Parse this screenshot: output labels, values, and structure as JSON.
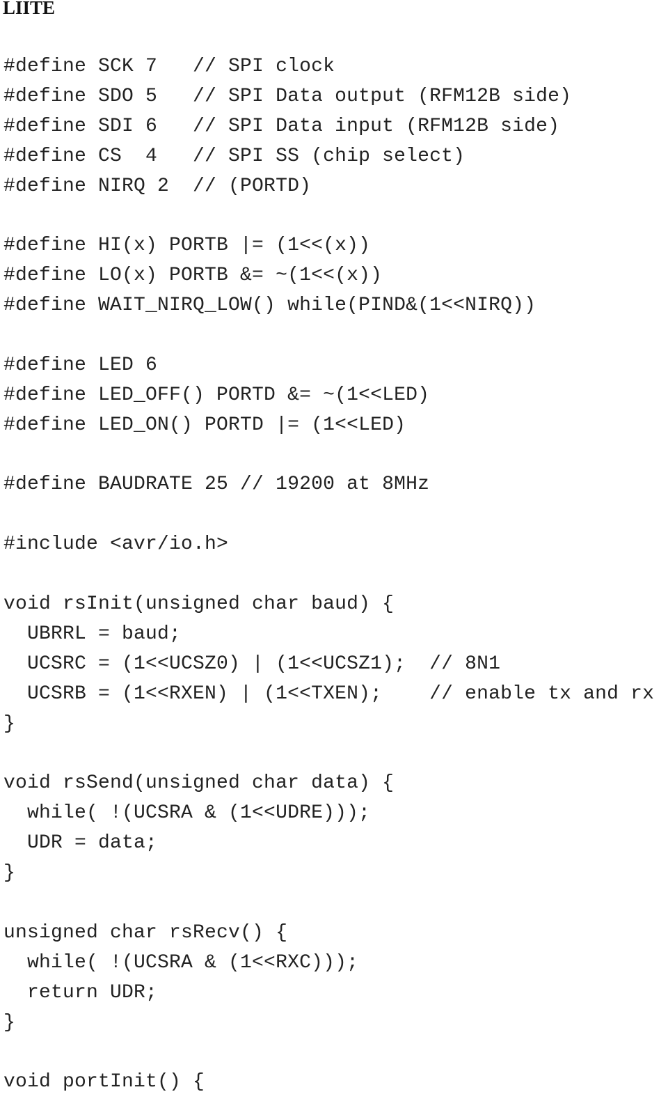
{
  "document": {
    "heading": "LIITE",
    "code_lines": [
      "#define SCK 7   // SPI clock",
      "#define SDO 5   // SPI Data output (RFM12B side)",
      "#define SDI 6   // SPI Data input (RFM12B side)",
      "#define CS  4   // SPI SS (chip select)",
      "#define NIRQ 2  // (PORTD)",
      "",
      "#define HI(x) PORTB |= (1<<(x))",
      "#define LO(x) PORTB &= ~(1<<(x))",
      "#define WAIT_NIRQ_LOW() while(PIND&(1<<NIRQ))",
      "",
      "#define LED 6",
      "#define LED_OFF() PORTD &= ~(1<<LED)",
      "#define LED_ON() PORTD |= (1<<LED)",
      "",
      "#define BAUDRATE 25 // 19200 at 8MHz",
      "",
      "#include <avr/io.h>",
      "",
      "void rsInit(unsigned char baud) {",
      "  UBRRL = baud;",
      "  UCSRC = (1<<UCSZ0) | (1<<UCSZ1);  // 8N1",
      "  UCSRB = (1<<RXEN) | (1<<TXEN);    // enable tx and rx",
      "}",
      "",
      "void rsSend(unsigned char data) {",
      "  while( !(UCSRA & (1<<UDRE)));",
      "  UDR = data;",
      "}",
      "",
      "unsigned char rsRecv() {",
      "  while( !(UCSRA & (1<<RXC)));",
      "  return UDR;",
      "}",
      "",
      "void portInit() {"
    ]
  }
}
